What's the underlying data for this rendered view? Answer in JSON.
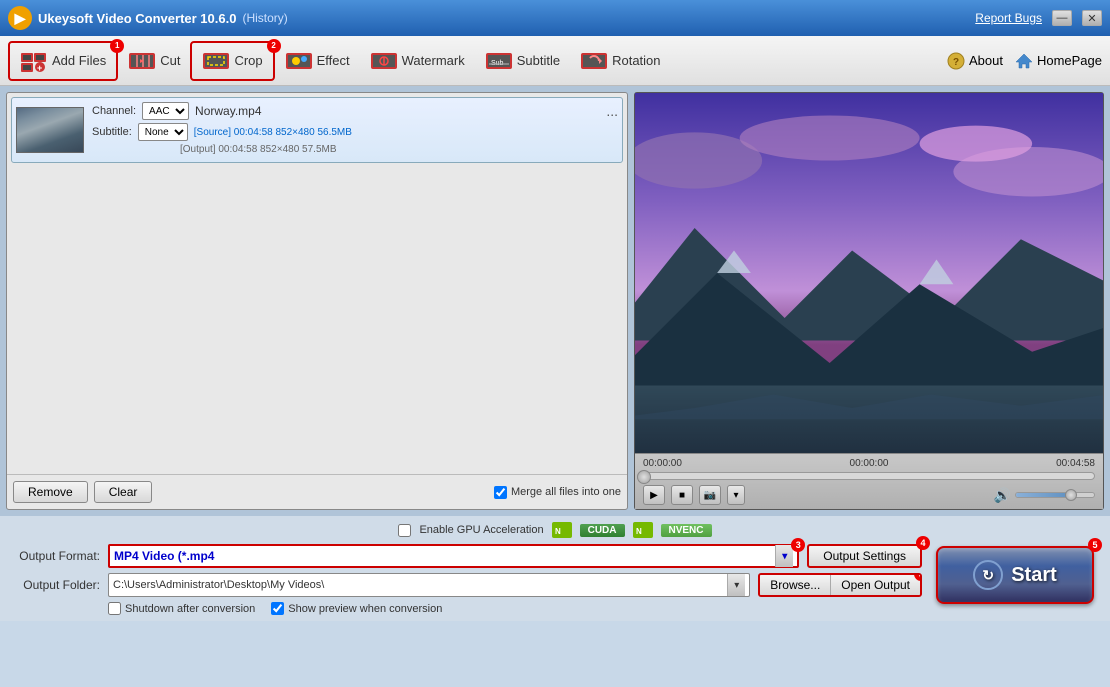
{
  "titlebar": {
    "app_name": "Ukeysoft Video Converter 10.6.0",
    "history_label": "(History)",
    "report_bugs": "Report Bugs",
    "minimize_label": "—",
    "close_label": "✕"
  },
  "toolbar": {
    "add_files_label": "Add Files",
    "cut_label": "Cut",
    "crop_label": "Crop",
    "effect_label": "Effect",
    "watermark_label": "Watermark",
    "subtitle_label": "Subtitle",
    "rotation_label": "Rotation",
    "about_label": "About",
    "homepage_label": "HomePage",
    "badge1": "1",
    "badge2": "2"
  },
  "file_list": {
    "items": [
      {
        "name": "Norway.mp4",
        "channel": "AAC",
        "subtitle": "None",
        "source": "[Source]  00:04:58  852×480  56.5MB",
        "output": "[Output]  00:04:58  852×480  57.5MB"
      }
    ],
    "remove_btn": "Remove",
    "clear_btn": "Clear",
    "merge_label": "Merge all files into one"
  },
  "preview": {
    "time_start": "00:00:00",
    "time_mid": "00:00:00",
    "time_end": "00:04:58"
  },
  "gpu": {
    "label": "Enable GPU Acceleration",
    "cuda_label": "CUDA",
    "nvenc_label": "NVENC"
  },
  "output": {
    "format_label": "Output Format:",
    "format_value": "MP4 Video (*.mp4",
    "folder_label": "Output Folder:",
    "folder_value": "C:\\Users\\Administrator\\Desktop\\My Videos\\",
    "settings_btn": "Output Settings",
    "browse_btn": "Browse...",
    "open_output_btn": "Open Output",
    "shutdown_label": "Shutdown after conversion",
    "show_preview_label": "Show preview when conversion",
    "badge3": "3",
    "badge4": "4",
    "badge5": "5",
    "badge6": "6"
  },
  "start_btn": {
    "label": "Start"
  }
}
